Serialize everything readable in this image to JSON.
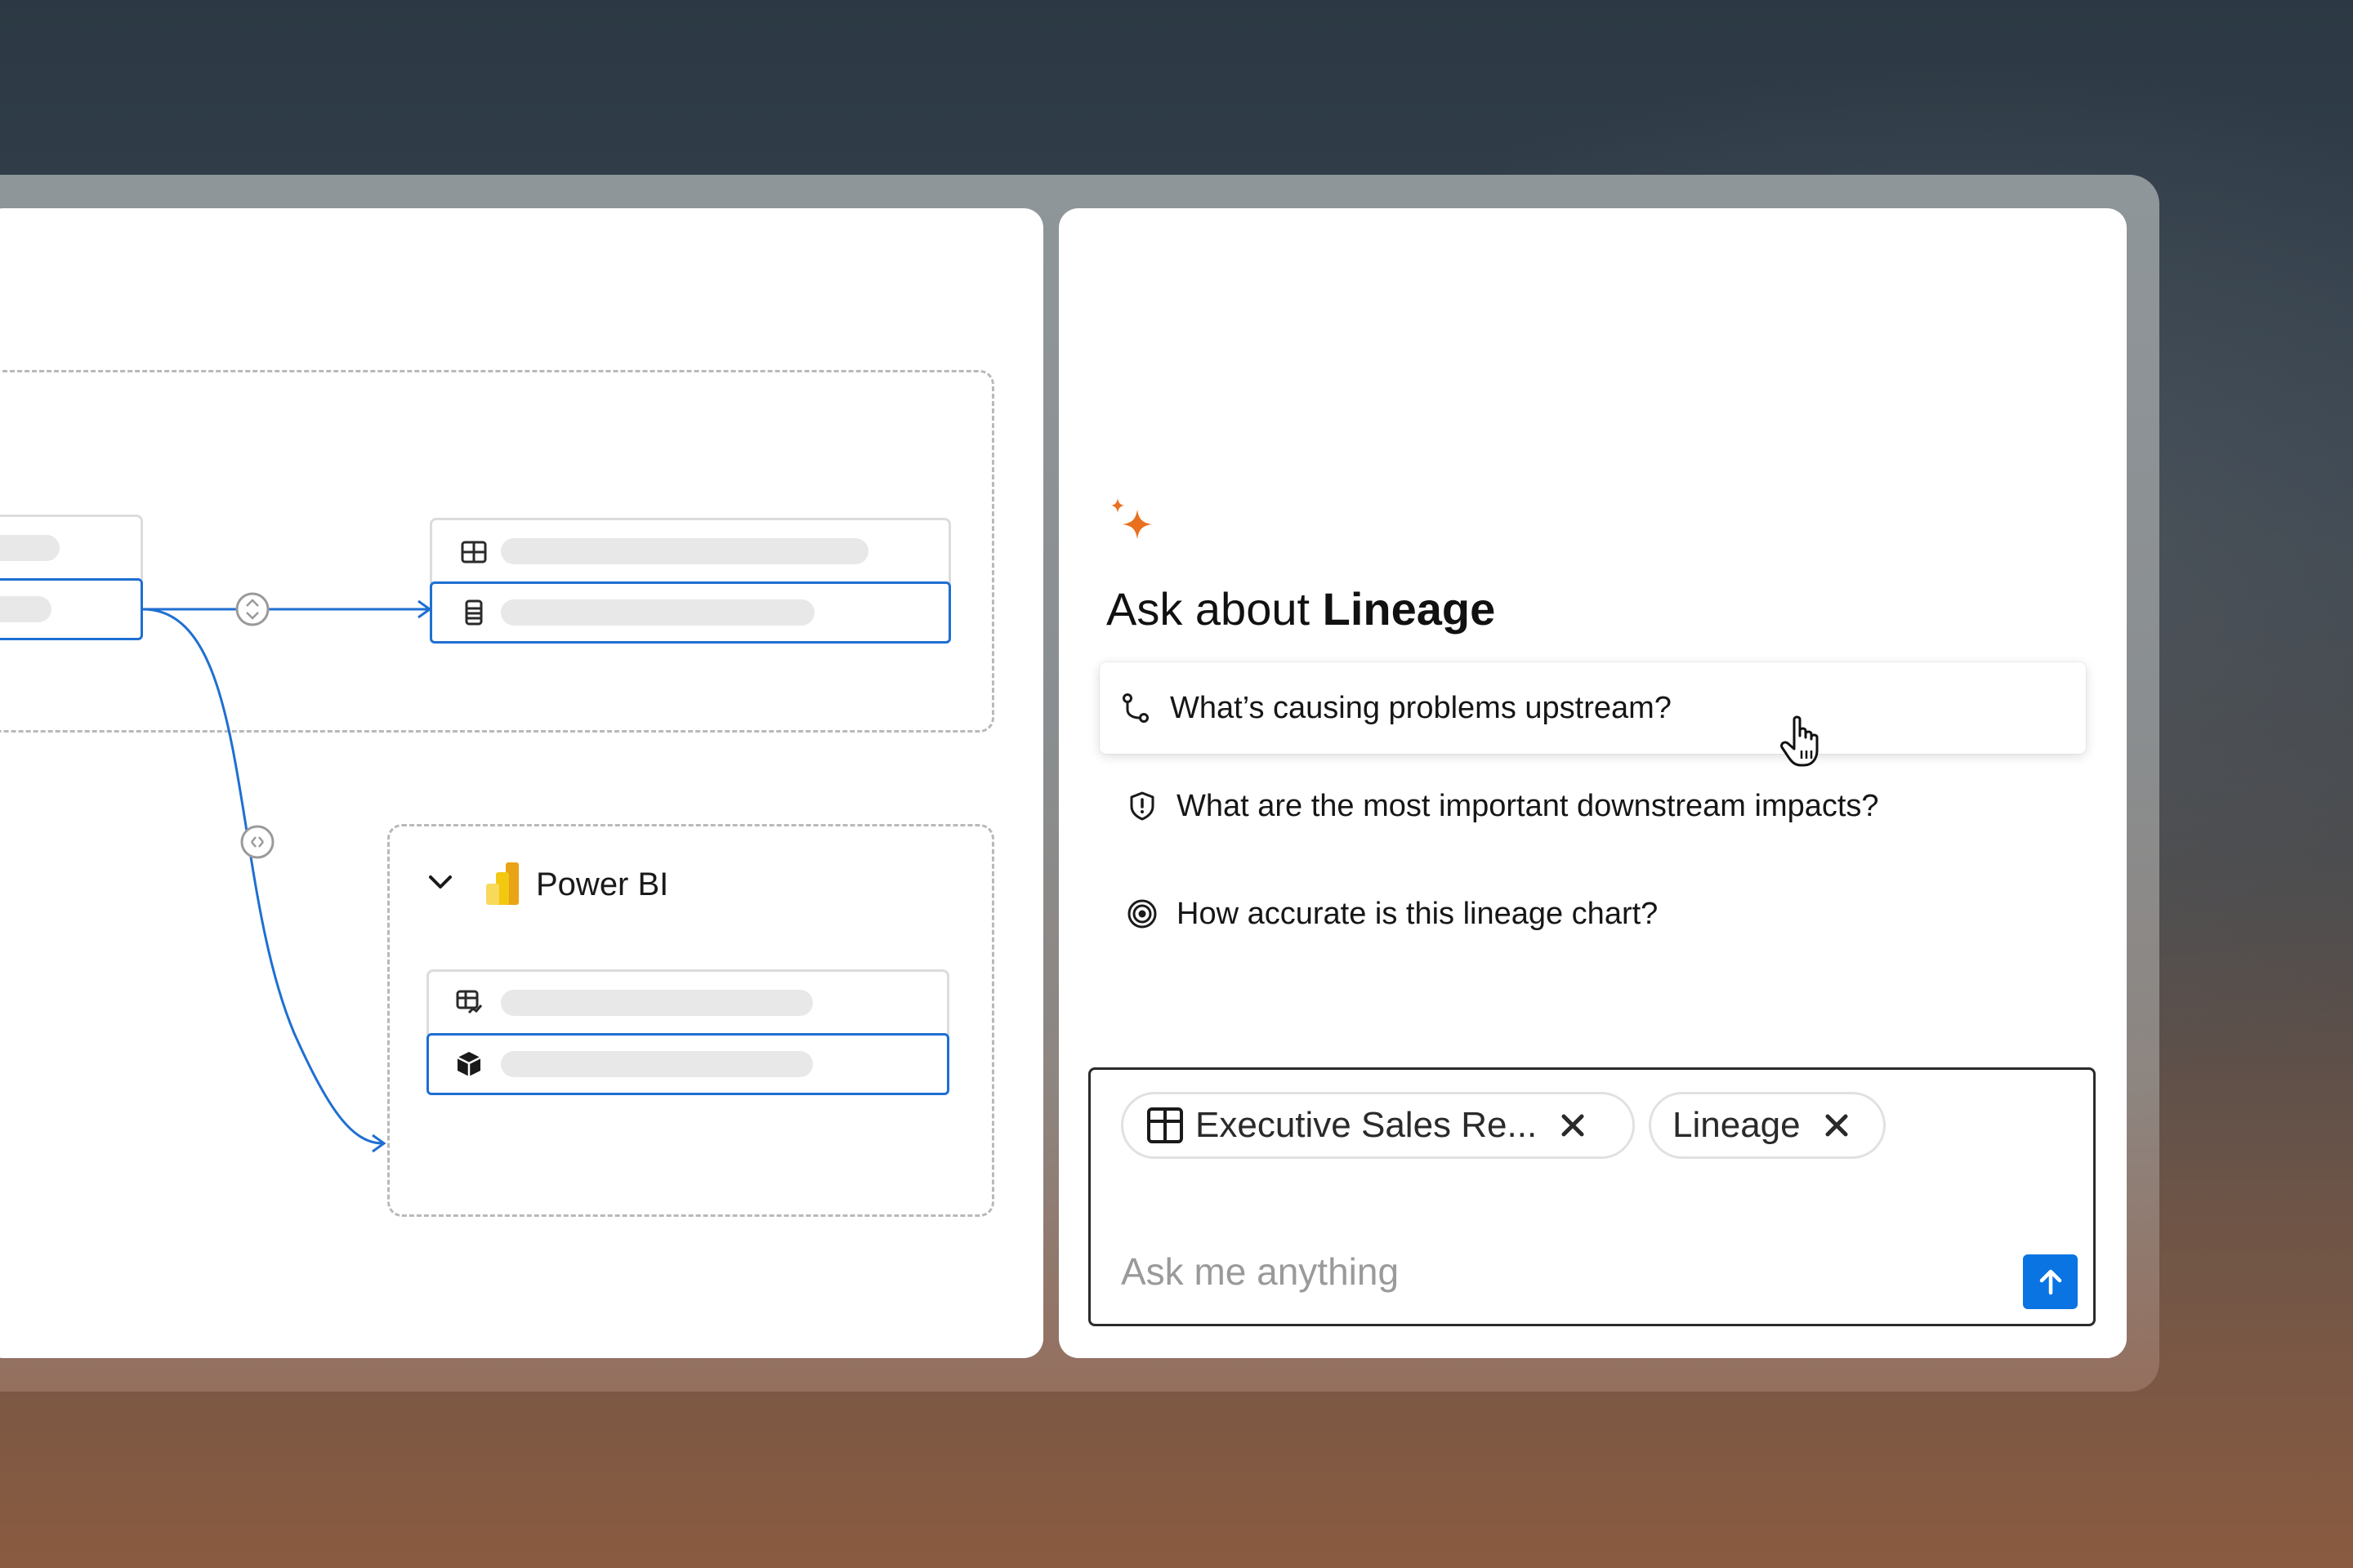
{
  "lineage": {
    "powerbi_group": {
      "title": "Power BI"
    }
  },
  "assistant": {
    "title_prefix": "Ask about",
    "title_subject": "Lineage",
    "suggestions": [
      {
        "label": "What’s causing problems upstream?",
        "icon": "branch-icon"
      },
      {
        "label": "What are the most important downstream impacts?",
        "icon": "shield-alert-icon"
      },
      {
        "label": "How accurate is this lineage chart?",
        "icon": "target-icon"
      }
    ],
    "composer": {
      "chips": [
        {
          "label": "Executive Sales Re...",
          "icon": "table-icon"
        },
        {
          "label": "Lineage"
        }
      ],
      "placeholder": "Ask me anything"
    }
  },
  "colors": {
    "accent": "#1f6fd1",
    "send_button": "#0a74e2",
    "sparkle": "#e8701e"
  }
}
